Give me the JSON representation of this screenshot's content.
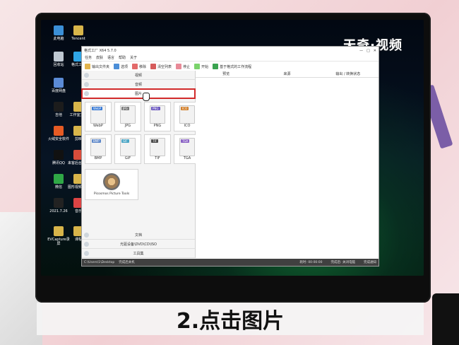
{
  "watermark": "天奇·视频",
  "caption": "2.点击图片",
  "desktop": {
    "icons": [
      {
        "label": "此电脑",
        "color": "#3b8fd6"
      },
      {
        "label": "Tencent",
        "color": "#d8b54a"
      },
      {
        "label": "回收站",
        "color": "#bfc8d2"
      },
      {
        "label": "格式工厂",
        "color": "#2fa5e6"
      },
      {
        "label": "百度网盘",
        "color": "#5b8bd6"
      },
      {
        "label": "吉他",
        "color": "#1c1c1c"
      },
      {
        "label": "工作室文件",
        "color": "#d8b54a"
      },
      {
        "label": "火绒安全软件",
        "color": "#e65b24"
      },
      {
        "label": "剪映",
        "color": "#d8b54a"
      },
      {
        "label": "腾讯QQ",
        "color": "#111"
      },
      {
        "label": "来客后台收卡",
        "color": "#d94c3b"
      },
      {
        "label": "微信",
        "color": "#2fa846"
      },
      {
        "label": "图形视频编辑",
        "color": "#d8b54a"
      },
      {
        "label": "2021.7.26",
        "color": "#222"
      },
      {
        "label": "音乐",
        "color": "#d44"
      },
      {
        "label": "EVCapture录屏",
        "color": "#d8b54a"
      },
      {
        "label": "课程",
        "color": "#d8b54a"
      }
    ]
  },
  "app": {
    "title": "格式工厂 X64 5.7.0",
    "menu": [
      "任务",
      "皮肤",
      "语言",
      "帮助",
      "关于"
    ],
    "toolbar": [
      "输出文件夹",
      "选项",
      "移除",
      "清空列表",
      "停止",
      "开始",
      "基于格式的工作流程"
    ],
    "categories": {
      "video": "视频",
      "audio": "音频",
      "image": "图片",
      "document": "文档",
      "rom": "光驱设备\\DVD\\CD\\ISO",
      "tools": "工具集"
    },
    "image_formats": [
      {
        "name": "WebP",
        "color": "#3a7bd5"
      },
      {
        "name": "JPG",
        "color": "#7a7a7a"
      },
      {
        "name": "PNG",
        "color": "#6b57c0"
      },
      {
        "name": "ICO",
        "color": "#d27f2a"
      },
      {
        "name": "BMP",
        "color": "#5e88c9"
      },
      {
        "name": "GIF",
        "color": "#4aa5c5"
      },
      {
        "name": "TIF",
        "color": "#4d4d4d"
      },
      {
        "name": "TGA",
        "color": "#8a62c5"
      }
    ],
    "picture_tools_label": "Picosmos Picture Tools",
    "table_headers": [
      "来源",
      "输出 / 转换状态",
      "预览"
    ],
    "status": {
      "path": "C:\\Users\\1\\Desktop",
      "checkbox": "完成后关机",
      "left": "耗时: 00:00:00",
      "right": "完成后: 关闭电脑",
      "notify": "完成通知"
    }
  }
}
